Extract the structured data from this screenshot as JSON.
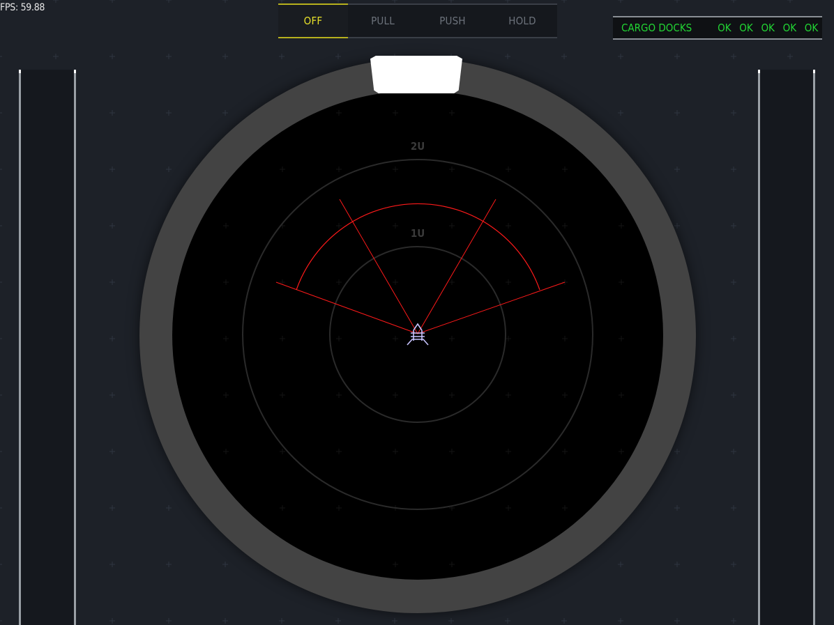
{
  "hud": {
    "fps": "FPS: 59.88"
  },
  "mode_selector": {
    "tabs": [
      {
        "label": "OFF",
        "active": true
      },
      {
        "label": "PULL",
        "active": false
      },
      {
        "label": "PUSH",
        "active": false
      },
      {
        "label": "HOLD",
        "active": false
      }
    ]
  },
  "cargo_docks": {
    "label": "CARGO DOCKS",
    "statuses": [
      "OK",
      "OK",
      "OK",
      "OK",
      "OK"
    ],
    "status_color": "#22d634"
  },
  "radar": {
    "range_labels": {
      "outer": "2U",
      "inner": "1U"
    },
    "colors": {
      "beam": "#ff1a1a",
      "ship": "#c8c4ff",
      "heading_marker": "#ffffff"
    }
  }
}
